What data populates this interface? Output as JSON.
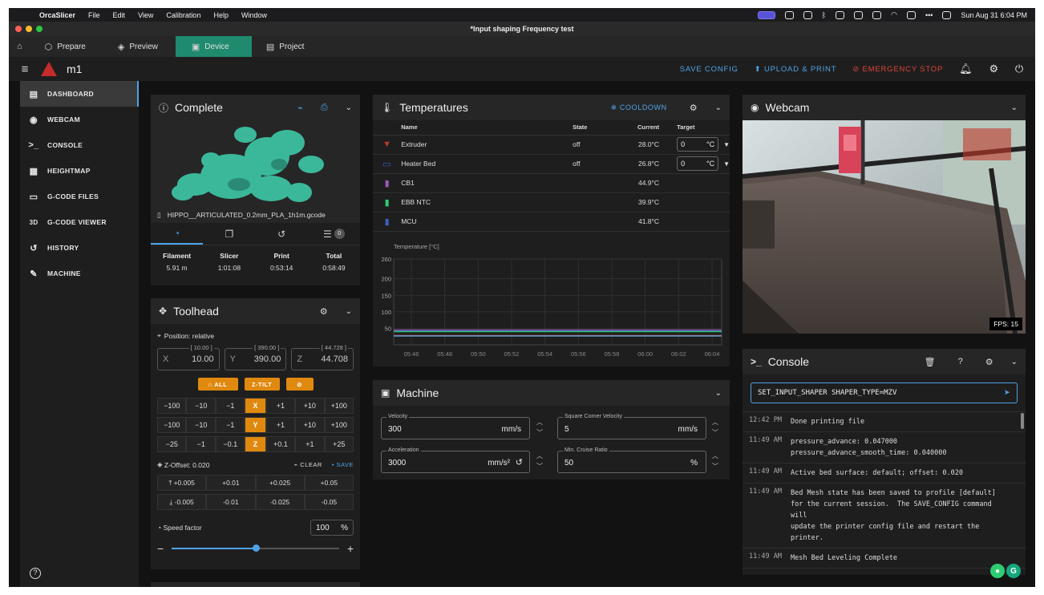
{
  "menubar": {
    "app_name": "OrcaSlicer",
    "items": [
      "File",
      "Edit",
      "View",
      "Calibration",
      "Help",
      "Window"
    ],
    "clock": "Sun Aug 31  6:04 PM"
  },
  "window": {
    "title": "*Input shaping Frequency test"
  },
  "tabs": [
    {
      "label": "Prepare",
      "icon": "cube-icon"
    },
    {
      "label": "Preview",
      "icon": "layers-icon"
    },
    {
      "label": "Device",
      "icon": "device-icon",
      "active": true
    },
    {
      "label": "Project",
      "icon": "project-icon"
    }
  ],
  "appbar": {
    "printer_name": "m1",
    "save_config": "SAVE CONFIG",
    "upload_print": "UPLOAD & PRINT",
    "emergency_stop": "EMERGENCY STOP"
  },
  "sidebar": {
    "items": [
      {
        "label": "DASHBOARD",
        "icon": "dashboard-icon",
        "glyph": "▤",
        "active": true
      },
      {
        "label": "WEBCAM",
        "icon": "webcam-icon",
        "glyph": "◉"
      },
      {
        "label": "CONSOLE",
        "icon": "console-icon",
        "glyph": ">_"
      },
      {
        "label": "HEIGHTMAP",
        "icon": "grid-icon",
        "glyph": "▦"
      },
      {
        "label": "G-CODE FILES",
        "icon": "files-icon",
        "glyph": "▭"
      },
      {
        "label": "G-CODE VIEWER",
        "icon": "3d-icon",
        "glyph": "3D"
      },
      {
        "label": "HISTORY",
        "icon": "history-icon",
        "glyph": "↺"
      },
      {
        "label": "MACHINE",
        "icon": "wrench-icon",
        "glyph": "✎"
      }
    ]
  },
  "status_panel": {
    "title": "Complete",
    "filename": "HIPPO__ARTICULATED_0.2mm_PLA_1h1m.gcode",
    "queue_count": "0",
    "stats": [
      {
        "label": "Filament",
        "value": "5.91 m"
      },
      {
        "label": "Slicer",
        "value": "1:01:08"
      },
      {
        "label": "Print",
        "value": "0:53:14"
      },
      {
        "label": "Total",
        "value": "0:58:49"
      }
    ]
  },
  "toolhead": {
    "title": "Toolhead",
    "position_label": "Position: relative",
    "axes": [
      {
        "axis": "X",
        "max": "[ 10.00 ]",
        "value": "10.00"
      },
      {
        "axis": "Y",
        "max": "[ 390.00 ]",
        "value": "390.00"
      },
      {
        "axis": "Z",
        "max": "[ 44.728 ]",
        "value": "44.708"
      }
    ],
    "home_all": "ALL",
    "z_tilt": "Z-TILT",
    "jog_rows": [
      [
        "−100",
        "−10",
        "−1",
        "X",
        "+1",
        "+10",
        "+100"
      ],
      [
        "−100",
        "−10",
        "−1",
        "Y",
        "+1",
        "+10",
        "+100"
      ],
      [
        "−25",
        "−1",
        "−0.1",
        "Z",
        "+0.1",
        "+1",
        "+25"
      ]
    ],
    "z_offset_label": "Z-Offset: 0.020",
    "clear": "CLEAR",
    "save": "SAVE",
    "z_up": [
      "+0.005",
      "+0.01",
      "+0.025",
      "+0.05"
    ],
    "z_down": [
      "-0.005",
      "-0.01",
      "-0.025",
      "-0.05"
    ],
    "speed_label": "Speed factor",
    "speed_value": "100",
    "speed_unit": "%",
    "speed_fraction": 0.5
  },
  "temperatures": {
    "title": "Temperatures",
    "cooldown": "COOLDOWN",
    "headers": {
      "name": "Name",
      "state": "State",
      "current": "Current",
      "target": "Target"
    },
    "rows": [
      {
        "name": "Extruder",
        "state": "off",
        "current": "28.0°C",
        "target": "0",
        "unit": "°C",
        "icon": "extruder-icon",
        "color": "#c0392b",
        "has_target": true
      },
      {
        "name": "Heater Bed",
        "state": "off",
        "current": "26.8°C",
        "target": "0",
        "unit": "°C",
        "icon": "bed-icon",
        "color": "#3b5fc0",
        "has_target": true
      },
      {
        "name": "CB1",
        "state": "",
        "current": "44.9°C",
        "icon": "thermometer-icon",
        "color": "#9b59b6"
      },
      {
        "name": "EBB NTC",
        "state": "",
        "current": "39.9°C",
        "icon": "thermometer-icon",
        "color": "#2ecc71"
      },
      {
        "name": "MCU",
        "state": "",
        "current": "41.8°C",
        "icon": "thermometer-icon",
        "color": "#3b5fc0"
      }
    ]
  },
  "chart_data": {
    "type": "line",
    "title": "",
    "ylabel": "Temperature [°C]",
    "xlabel": "",
    "ylim": [
      0,
      260
    ],
    "yticks": [
      50,
      100,
      150,
      200,
      260
    ],
    "categories": [
      "05:46",
      "05:48",
      "05:50",
      "05:52",
      "05:54",
      "05:56",
      "05:58",
      "06:00",
      "06:02",
      "06:04"
    ],
    "grid": true,
    "series": [
      {
        "color": "#9b59b6",
        "values": [
          44.9,
          44.9,
          44.9,
          44.9,
          44.9,
          44.9,
          44.9,
          44.9,
          44.9,
          44.9
        ]
      },
      {
        "color": "#3b5fc0",
        "values": [
          41.8,
          41.8,
          41.8,
          41.8,
          41.8,
          41.8,
          41.8,
          41.8,
          41.8,
          41.8
        ]
      },
      {
        "color": "#2ecc71",
        "values": [
          39.9,
          39.9,
          39.9,
          39.9,
          39.9,
          39.9,
          39.9,
          39.9,
          39.9,
          39.9
        ]
      },
      {
        "color": "#c0392b",
        "values": [
          28.0,
          28.0,
          28.0,
          28.0,
          28.0,
          28.0,
          28.0,
          28.0,
          28.0,
          28.0
        ]
      },
      {
        "color": "#5dade2",
        "values": [
          26.8,
          26.8,
          26.8,
          26.8,
          26.8,
          26.8,
          26.8,
          26.8,
          26.8,
          26.8
        ]
      }
    ]
  },
  "machine": {
    "title": "Machine",
    "fields": [
      {
        "label": "Velocity",
        "value": "300",
        "unit": "mm/s"
      },
      {
        "label": "Square Corner Velocity",
        "value": "5",
        "unit": "mm/s"
      },
      {
        "label": "Acceleration",
        "value": "3000",
        "unit": "mm/s²"
      },
      {
        "label": "Min. Cruise Ratio",
        "value": "50",
        "unit": "%"
      }
    ]
  },
  "webcam": {
    "title": "Webcam",
    "fps": "FPS: 15"
  },
  "console": {
    "title": "Console",
    "input": "SET_INPUT_SHAPER SHAPER_TYPE=MZV",
    "log": [
      {
        "time": "12:42 PM",
        "msg": "Done printing file"
      },
      {
        "time": "11:49 AM",
        "msg": "pressure_advance: 0.047000\npressure_advance_smooth_time: 0.040000"
      },
      {
        "time": "11:49 AM",
        "msg": "Active bed surface: default; offset: 0.020"
      },
      {
        "time": "11:49 AM",
        "msg": "Bed Mesh state has been saved to profile [default]\nfor the current session.  The SAVE_CONFIG command\nwill\nupdate the printer config file and restart the\nprinter."
      },
      {
        "time": "11:49 AM",
        "msg": "Mesh Bed Leveling Complete"
      }
    ]
  },
  "colors": {
    "accent": "#4ea3e8",
    "tab_active": "#1f8a6e",
    "orange": "#e0890f",
    "danger": "#e0443b"
  }
}
